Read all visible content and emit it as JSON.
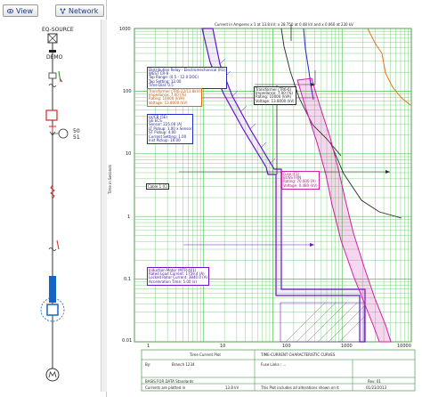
{
  "toolbar": {
    "view_label": "View",
    "network_label": "Network"
  },
  "one_line": {
    "source_label": "EQ-SOURCE",
    "demo_label": "DEMO",
    "relay_label_1": "50",
    "relay_label_2": "51"
  },
  "tcc": {
    "header_title": "Current in Amperes x 1 at 13.8 kV; x 28.750 at 0.48 kV and x 0.060 at 230 kV",
    "y_axis_title": "Time in Seconds",
    "y_ticks": [
      "1000",
      "100",
      "10",
      "1",
      "0.1",
      "0.01"
    ],
    "x_ticks": [
      "1",
      "10",
      "100",
      "1000",
      "10000"
    ],
    "annotations": {
      "relay": [
        "Distribution Relay - Electromechanical (R1)",
        "WEST CR-9",
        "Tap Range: (0.5 - 12.0 DOC)",
        "Tap Setting: 12.00",
        "Time Dial: 0.5"
      ],
      "transformer_hv": [
        "Transformer (TR6-22/13.8kV)",
        "Impedance: 7.00 (%)",
        "Rating: 10000 (kVA)",
        "Voltage: 13.8000 (kV)"
      ],
      "lv_cb": [
        "LV/CB (5E)",
        "GE ECS",
        "Sensor: 225.00 (A)",
        "LT Pickup: 1.00 x Sensor",
        "ST Pickup: 4.00",
        "Current Setting: 1.00",
        "Inst Pickup: 10.00"
      ],
      "transformer_lv": [
        "Transformer (TR6-6)",
        "Impedance: 7.00 (%)",
        "Rating: 10000 (kVA)",
        "Voltage: 13.8000 (kV)"
      ],
      "fuse": [
        "Fuse (F1)",
        "BUSS FRN",
        "Rating: 70.000 (A)",
        "Voltage: 0.480 (kV)"
      ],
      "cable": [
        "Cable 1 (C)"
      ],
      "motor": [
        "Induction Motor (MTR-401)",
        "Rated Load Current: 1759.4 (A)",
        "Locked Rotor Current: 3840.0 (A)",
        "Acceleration Time: 5.00 (s)"
      ]
    },
    "title_block": {
      "label_time_current": "Time Current Plot",
      "label_tcc": "TIME-CURRENT CHARACTERISTIC CURVES",
      "label_by": "By:",
      "value_by": "Branch 1234",
      "label_fuse": "Fuse Links : ...",
      "label_basis": "BASIS FOR DATA  Standards",
      "label_currents": "Currents are plotted in",
      "value_kv": "13.8 kV",
      "label_note": "This Plot includes all alterations shown on it",
      "label_rev": "Rev: 01",
      "label_date": "01/23/2013"
    }
  },
  "colors": {
    "grid_green": "#4fc24f",
    "relay_purple": "#6a14c8",
    "fuse_magenta": "#d21ea8",
    "transformer_orange": "#e06a10",
    "cb_blue": "#1b2ad0",
    "dark_curve": "#2a2a2a",
    "sld_red": "#d12a2a",
    "sld_blue": "#1566c4"
  }
}
